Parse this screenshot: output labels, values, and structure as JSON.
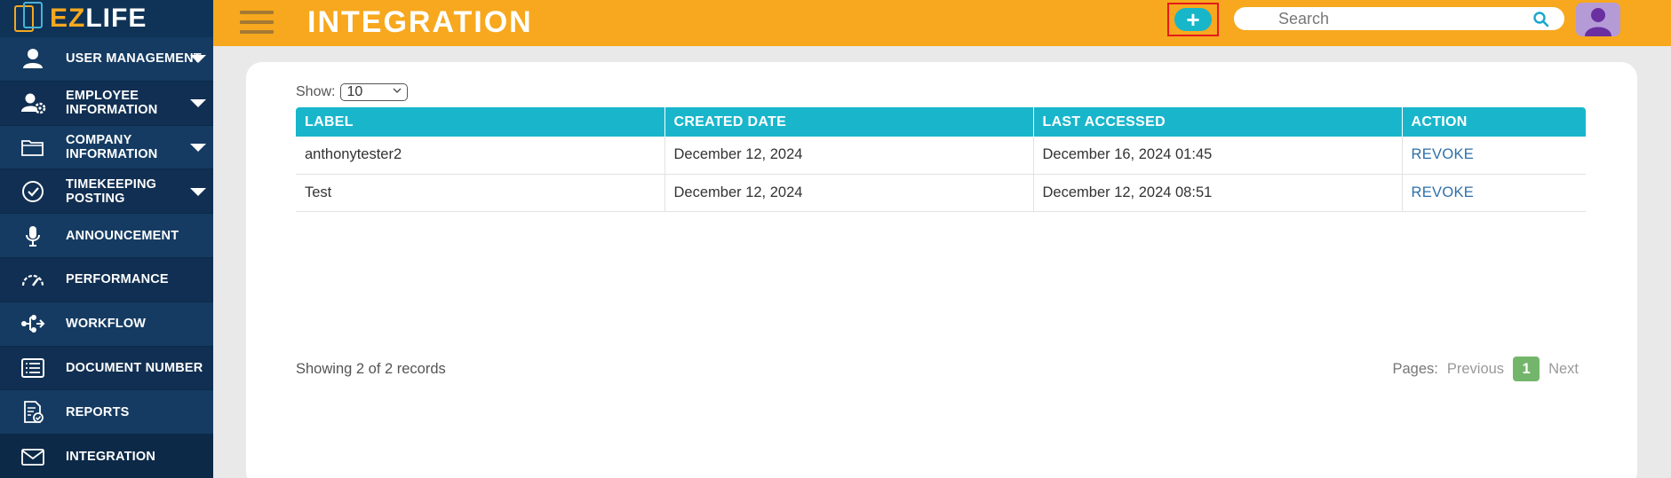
{
  "app": {
    "logo_ez": "EZ",
    "logo_life": "LIFE"
  },
  "header": {
    "title": "INTEGRATION",
    "add_label": "+",
    "search_placeholder": "Search"
  },
  "sidebar": {
    "items": [
      {
        "label": "USER MANAGEMENT",
        "icon": "user-icon",
        "has_caret": true
      },
      {
        "label": "EMPLOYEE INFORMATION",
        "icon": "user-gear-icon",
        "has_caret": true
      },
      {
        "label": "COMPANY INFORMATION",
        "icon": "folder-icon",
        "has_caret": true
      },
      {
        "label": "TIMEKEEPING POSTING",
        "icon": "check-circle-icon",
        "has_caret": true
      },
      {
        "label": "ANNOUNCEMENT",
        "icon": "microphone-icon",
        "has_caret": false
      },
      {
        "label": "PERFORMANCE",
        "icon": "gauge-icon",
        "has_caret": false
      },
      {
        "label": "WORKFLOW",
        "icon": "workflow-icon",
        "has_caret": false
      },
      {
        "label": "DOCUMENT NUMBER",
        "icon": "document-list-icon",
        "has_caret": false
      },
      {
        "label": "REPORTS",
        "icon": "report-icon",
        "has_caret": false
      },
      {
        "label": "INTEGRATION",
        "icon": "envelope-icon",
        "has_caret": false
      }
    ]
  },
  "main": {
    "show_label": "Show:",
    "show_value": "10",
    "table": {
      "columns": [
        "LABEL",
        "CREATED DATE",
        "LAST ACCESSED",
        "ACTION"
      ],
      "rows": [
        {
          "label": "anthonytester2",
          "created": "December 12, 2024",
          "last_accessed": "December 16, 2024 01:45",
          "action": "REVOKE"
        },
        {
          "label": "Test",
          "created": "December 12, 2024",
          "last_accessed": "December 12, 2024 08:51",
          "action": "REVOKE"
        }
      ]
    },
    "records_text": "Showing 2 of 2 records",
    "pager": {
      "label": "Pages:",
      "previous": "Previous",
      "current": "1",
      "next": "Next"
    }
  },
  "colors": {
    "header": "#f7a81e",
    "sidebar": "#0f3356",
    "table_header": "#19b6cb",
    "link": "#2d6fa8",
    "page_active": "#73b66b",
    "highlight_border": "#e41b1b"
  }
}
